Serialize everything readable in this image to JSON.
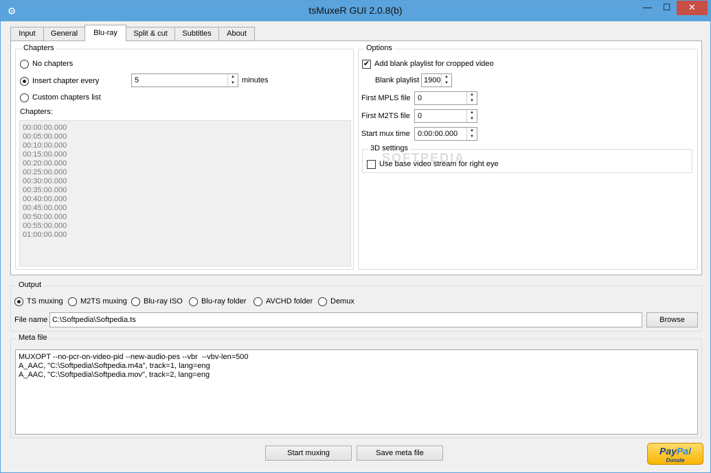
{
  "window": {
    "title": "tsMuxeR GUI 2.0.8(b)",
    "controls": {
      "minimize": "—",
      "maximize": "☐",
      "close": "✕"
    }
  },
  "tabs": [
    "Input",
    "General",
    "Blu-ray",
    "Split & cut",
    "Subtitles",
    "About"
  ],
  "active_tab": "Blu-ray",
  "chapters": {
    "legend": "Chapters",
    "no_chapters": "No chapters",
    "insert_every": "Insert chapter every",
    "interval_value": "5",
    "interval_unit": "minutes",
    "custom_list": "Custom chapters list",
    "list_label": "Chapters:",
    "selected": "insert_every",
    "items": [
      "00:00:00.000",
      "00:05:00.000",
      "00:10:00.000",
      "00:15:00.000",
      "00:20:00.000",
      "00:25:00.000",
      "00:30:00.000",
      "00:35:00.000",
      "00:40:00.000",
      "00:45:00.000",
      "00:50:00.000",
      "00:55:00.000",
      "01:00:00.000"
    ]
  },
  "options": {
    "legend": "Options",
    "add_blank_playlist": "Add blank playlist for cropped video",
    "add_blank_playlist_checked": true,
    "blank_playlist_label": "Blank playlist",
    "blank_playlist_value": "1900",
    "first_mpls_label": "First MPLS file",
    "first_mpls_value": "0",
    "first_m2ts_label": "First M2TS file",
    "first_m2ts_value": "0",
    "start_mux_label": "Start mux time",
    "start_mux_value": "0:00:00.000",
    "settings_3d_legend": "3D settings",
    "base_video_right_eye": "Use base video stream for right eye",
    "base_video_right_eye_checked": false
  },
  "output": {
    "legend": "Output",
    "modes": [
      "TS muxing",
      "M2TS muxing",
      "Blu-ray ISO",
      "Blu-ray folder",
      "AVCHD folder",
      "Demux"
    ],
    "selected_mode": "TS muxing",
    "file_name_label": "File name",
    "file_name_value": "C:\\Softpedia\\Softpedia.ts",
    "browse": "Browse"
  },
  "meta": {
    "legend": "Meta file",
    "text": "MUXOPT --no-pcr-on-video-pid --new-audio-pes --vbr  --vbv-len=500\nA_AAC, \"C:\\Softpedia\\Softpedia.m4a\", track=1, lang=eng\nA_AAC, \"C:\\Softpedia\\Softpedia.mov\", track=2, lang=eng"
  },
  "actions": {
    "start_muxing": "Start muxing",
    "save_meta": "Save meta file"
  },
  "paypal": {
    "pay": "Pay",
    "pal": "Pal",
    "donate": "Donate"
  },
  "watermark": "SOFTPEDIA",
  "colors": {
    "titlebar": "#5aa3dc",
    "close": "#c74f45",
    "paypal": "#f7b500"
  },
  "icons": {
    "app": "gear-icon",
    "checked": "checkmark-icon",
    "spin_up": "spin-up-icon",
    "spin_down": "spin-down-icon"
  }
}
